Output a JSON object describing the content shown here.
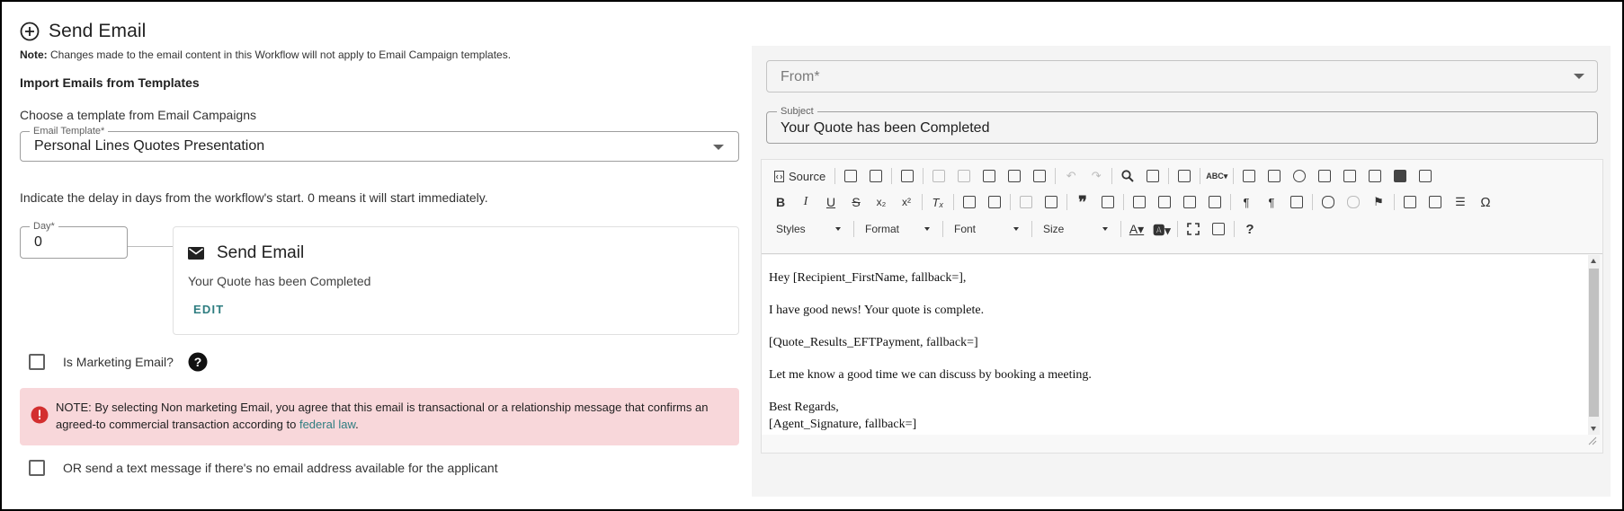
{
  "header": {
    "title": "Send Email"
  },
  "note": {
    "label": "Note:",
    "text": " Changes made to the email content in this Workflow will not apply to Email Campaign templates."
  },
  "import": {
    "title": "Import Emails from Templates",
    "hint": "Choose a template from Email Campaigns",
    "template_label": "Email Template*",
    "template_value": "Personal Lines Quotes Presentation"
  },
  "delay": {
    "hint": "Indicate the delay in days from the workflow's start. 0 means it will start immediately.",
    "day_label": "Day*",
    "day_value": "0"
  },
  "card": {
    "title": "Send Email",
    "subject": "Your Quote has been Completed",
    "edit_label": "EDIT"
  },
  "marketing": {
    "label": "Is Marketing Email?"
  },
  "alert": {
    "text": "NOTE: By selecting Non marketing Email, you agree that this email is transactional or a relationship message that confirms an agreed-to commercial transaction according to ",
    "link": "federal law",
    "end": "."
  },
  "sms": {
    "label": "OR send a text message if there's no email address available for the applicant"
  },
  "form": {
    "from_placeholder": "From*",
    "subject_label": "Subject",
    "subject_value": "Your Quote has been Completed"
  },
  "toolbar": {
    "source_label": "Source",
    "styles_label": "Styles",
    "format_label": "Format",
    "font_label": "Font",
    "size_label": "Size",
    "bold": "B",
    "italic": "I",
    "underline": "U",
    "strike": "S",
    "omega": "Ω",
    "help": "?"
  },
  "email_body": {
    "greeting": "Hey [Recipient_FirstName, fallback=],",
    "line1": "I have good news! Your quote is complete.",
    "line2": "[Quote_Results_EFTPayment, fallback=]",
    "line3": "Let me know a good time we can discuss by booking a meeting.",
    "closing": "Best Regards,",
    "signature": "[Agent_Signature, fallback=]"
  },
  "colors": {
    "accent": "#2e7d80",
    "alert_bg": "#f8d7da",
    "error_red": "#d32f2f"
  }
}
